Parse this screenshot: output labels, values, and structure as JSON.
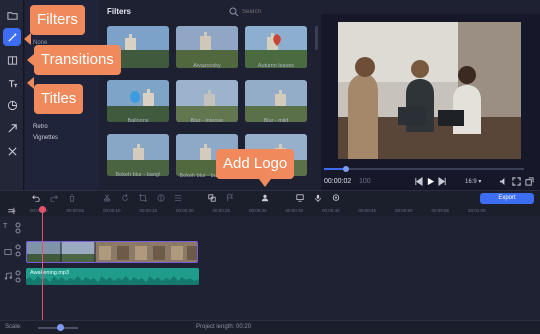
{
  "callouts": {
    "filters": "Filters",
    "transitions": "Transitions",
    "titles": "Titles",
    "add_logo": "Add Logo"
  },
  "sidebar": {
    "categories": [
      "None",
      "Retro",
      "Vignettes"
    ]
  },
  "panel": {
    "title": "Filters",
    "search_placeholder": "Search"
  },
  "filter_grid": [
    {
      "label": ""
    },
    {
      "label": "Aivazovsky"
    },
    {
      "label": "Autumn leaves"
    },
    {
      "label": "Balloons"
    },
    {
      "label": "Blur - intense"
    },
    {
      "label": "Blur - mild"
    },
    {
      "label": "Bokeh blur - bang!"
    },
    {
      "label": "Bokeh blur - butterflies"
    },
    {
      "label": ""
    }
  ],
  "preview": {
    "timecode": "00:00:02",
    "timecode_frames": "100",
    "aspect": "16:9 ▾",
    "progress_fraction": 0.11
  },
  "toolbar": {
    "export_label": "Export"
  },
  "timeline": {
    "ruler_ticks": [
      "00:00:00",
      "00:00:05",
      "00:00:10",
      "00:00:15",
      "00:00:20",
      "00:00:25",
      "00:00:30",
      "00:00:35",
      "00:00:40",
      "00:00:45",
      "00:00:50",
      "00:00:55",
      "00:01:00"
    ],
    "audio_clip_label": "Awakening.mp3"
  },
  "statusbar": {
    "scale_label": "Scale:",
    "project_length": "Project length:  00:20"
  },
  "colors": {
    "accent": "#3d6df2",
    "callout": "#f08a5d",
    "playhead": "#e8516b",
    "audio_clip": "#1f9c8c",
    "video_clip_border": "#7a5cd6"
  }
}
